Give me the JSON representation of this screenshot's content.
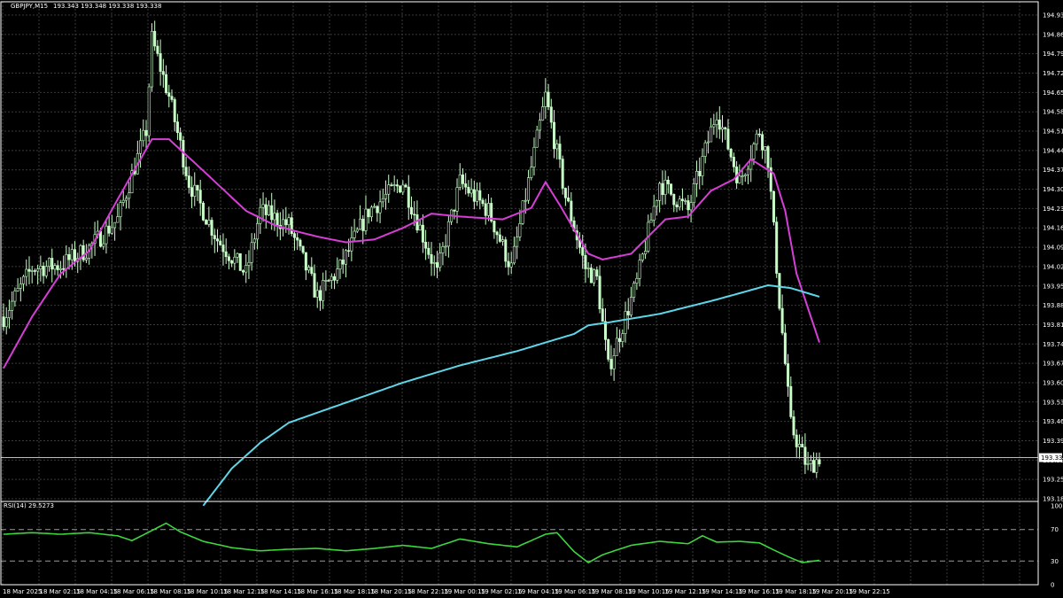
{
  "header": {
    "symbol": "GBPJPY,M15",
    "ohlc": "193.343 193.348 193.338 193.338"
  },
  "colors": {
    "background": "#000000",
    "grid": "#3a3a3a",
    "frame": "#ffffff",
    "candle": "#c8ffc8",
    "ma_fast": "#d63fd6",
    "ma_slow": "#5fd6e8",
    "rsi": "#3ed63e"
  },
  "chart_data": [
    {
      "type": "candlestick",
      "title": "GBPJPY,M15",
      "ylim": [
        193.185,
        194.93
      ],
      "yticks": [
        "194.930",
        "194.860",
        "194.790",
        "194.720",
        "194.650",
        "194.580",
        "194.510",
        "194.440",
        "194.370",
        "194.300",
        "194.230",
        "194.160",
        "194.095",
        "194.025",
        "193.955",
        "193.885",
        "193.815",
        "193.745",
        "193.675",
        "193.605",
        "193.535",
        "193.465",
        "193.395",
        "193.325",
        "193.255",
        "193.185"
      ],
      "xticks": [
        "18 Mar 2025",
        "18 Mar 02:15",
        "18 Mar 04:15",
        "18 Mar 06:15",
        "18 Mar 08:15",
        "18 Mar 10:15",
        "18 Mar 12:15",
        "18 Mar 14:15",
        "18 Mar 16:15",
        "18 Mar 18:15",
        "18 Mar 20:15",
        "18 Mar 22:15",
        "19 Mar 00:15",
        "19 Mar 02:15",
        "19 Mar 04:15",
        "19 Mar 06:15",
        "19 Mar 08:15",
        "19 Mar 10:15",
        "19 Mar 12:15",
        "19 Mar 14:15",
        "19 Mar 16:15",
        "19 Mar 18:15",
        "19 Mar 20:15",
        "19 Mar 22:15"
      ],
      "current_price": "193.338",
      "close_anchors": [
        [
          0,
          193.83
        ],
        [
          10,
          194.0
        ],
        [
          20,
          194.01
        ],
        [
          30,
          194.07
        ],
        [
          40,
          194.17
        ],
        [
          50,
          194.48
        ],
        [
          52,
          194.8
        ],
        [
          58,
          194.6
        ],
        [
          65,
          194.3
        ],
        [
          75,
          194.1
        ],
        [
          85,
          193.98
        ],
        [
          90,
          194.2
        ],
        [
          100,
          194.15
        ],
        [
          110,
          193.9
        ],
        [
          118,
          194.0
        ],
        [
          128,
          194.2
        ],
        [
          140,
          194.3
        ],
        [
          152,
          193.98
        ],
        [
          160,
          194.3
        ],
        [
          170,
          194.2
        ],
        [
          178,
          194.0
        ],
        [
          186,
          194.4
        ],
        [
          190,
          194.6
        ],
        [
          197,
          194.25
        ],
        [
          204,
          194.0
        ],
        [
          208,
          193.96
        ],
        [
          212,
          193.65
        ],
        [
          222,
          193.95
        ],
        [
          230,
          194.3
        ],
        [
          240,
          194.2
        ],
        [
          250,
          194.55
        ],
        [
          258,
          194.3
        ],
        [
          265,
          194.48
        ],
        [
          268,
          194.38
        ],
        [
          272,
          193.88
        ],
        [
          276,
          193.45
        ],
        [
          282,
          193.3
        ],
        [
          286,
          193.34
        ]
      ],
      "ma_fast": [
        [
          0,
          193.65
        ],
        [
          10,
          193.83
        ],
        [
          20,
          193.98
        ],
        [
          30,
          194.06
        ],
        [
          40,
          194.24
        ],
        [
          52,
          194.45
        ],
        [
          58,
          194.45
        ],
        [
          70,
          194.34
        ],
        [
          85,
          194.2
        ],
        [
          95,
          194.15
        ],
        [
          102,
          194.13
        ],
        [
          110,
          194.11
        ],
        [
          120,
          194.09
        ],
        [
          130,
          194.1
        ],
        [
          140,
          194.14
        ],
        [
          150,
          194.19
        ],
        [
          160,
          194.18
        ],
        [
          175,
          194.17
        ],
        [
          185,
          194.21
        ],
        [
          190,
          194.3
        ],
        [
          195,
          194.22
        ],
        [
          205,
          194.05
        ],
        [
          210,
          194.03
        ],
        [
          220,
          194.05
        ],
        [
          232,
          194.17
        ],
        [
          240,
          194.18
        ],
        [
          248,
          194.27
        ],
        [
          256,
          194.31
        ],
        [
          262,
          194.38
        ],
        [
          270,
          194.33
        ],
        [
          274,
          194.2
        ],
        [
          278,
          193.98
        ],
        [
          286,
          193.74
        ]
      ],
      "ma_slow": [
        [
          70,
          193.17
        ],
        [
          80,
          193.3
        ],
        [
          90,
          193.39
        ],
        [
          100,
          193.46
        ],
        [
          120,
          193.53
        ],
        [
          140,
          193.6
        ],
        [
          160,
          193.66
        ],
        [
          180,
          193.71
        ],
        [
          200,
          193.77
        ],
        [
          205,
          193.8
        ],
        [
          212,
          193.81
        ],
        [
          230,
          193.84
        ],
        [
          250,
          193.89
        ],
        [
          268,
          193.94
        ],
        [
          276,
          193.93
        ],
        [
          286,
          193.9
        ]
      ],
      "candle_count": 287
    },
    {
      "type": "line",
      "title": "RSI(14) 29.5273",
      "series_name": "RSI(14)",
      "value": "29.5273",
      "ylim": [
        0,
        100
      ],
      "yticks": [
        "100",
        "70",
        "30",
        "0"
      ],
      "levels": [
        70,
        30
      ],
      "rsi": [
        [
          0,
          64
        ],
        [
          10,
          66
        ],
        [
          20,
          64
        ],
        [
          30,
          66
        ],
        [
          40,
          62
        ],
        [
          45,
          56
        ],
        [
          50,
          65
        ],
        [
          57,
          78
        ],
        [
          62,
          67
        ],
        [
          70,
          55
        ],
        [
          80,
          47
        ],
        [
          90,
          43
        ],
        [
          100,
          45
        ],
        [
          110,
          46
        ],
        [
          120,
          43
        ],
        [
          130,
          46
        ],
        [
          140,
          50
        ],
        [
          150,
          46
        ],
        [
          160,
          58
        ],
        [
          170,
          52
        ],
        [
          180,
          48
        ],
        [
          190,
          64
        ],
        [
          194,
          66
        ],
        [
          200,
          42
        ],
        [
          205,
          28
        ],
        [
          210,
          38
        ],
        [
          220,
          50
        ],
        [
          230,
          55
        ],
        [
          240,
          52
        ],
        [
          245,
          62
        ],
        [
          250,
          54
        ],
        [
          258,
          55
        ],
        [
          265,
          53
        ],
        [
          270,
          44
        ],
        [
          276,
          34
        ],
        [
          280,
          28
        ],
        [
          286,
          31
        ]
      ]
    }
  ]
}
